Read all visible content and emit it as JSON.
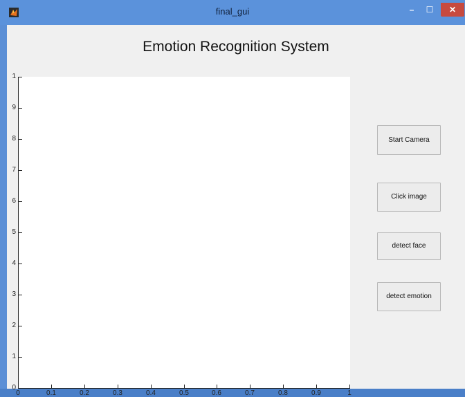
{
  "window": {
    "title": "final_gui",
    "minimize_label": "–",
    "maximize_label": "☐",
    "close_label": "✕"
  },
  "app": {
    "heading": "Emotion Recognition System"
  },
  "axes": {
    "y_ticks": [
      "1",
      "9",
      "8",
      "7",
      "6",
      "5",
      "4",
      "3",
      "2",
      "1",
      "0"
    ],
    "x_ticks": [
      "0",
      "0.1",
      "0.2",
      "0.3",
      "0.4",
      "0.5",
      "0.6",
      "0.7",
      "0.8",
      "0.9",
      "1"
    ]
  },
  "buttons": {
    "start_camera": "Start Camera",
    "click_image": "Click image",
    "detect_face": "detect face",
    "detect_emotion": "detect emotion"
  },
  "colors": {
    "titlebar": "#5b92db",
    "close": "#c74a3f",
    "client_bg": "#f0f0f0",
    "axes_bg": "#ffffff"
  }
}
